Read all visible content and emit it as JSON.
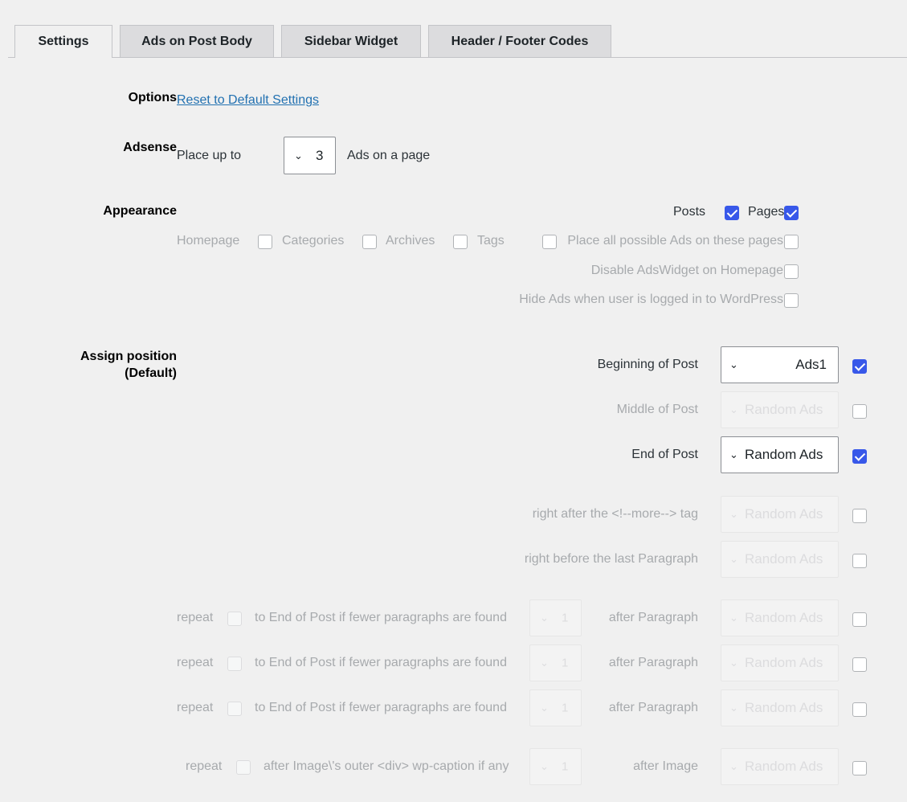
{
  "tabs": [
    "Settings",
    "Ads on Post Body",
    "Sidebar Widget",
    "Header / Footer Codes"
  ],
  "options": {
    "label": "Options",
    "reset_link": "Reset to Default Settings"
  },
  "adsense": {
    "label": "Adsense",
    "prefix": "Place up to",
    "count": "3",
    "suffix": "Ads on a page"
  },
  "appearance": {
    "label": "Appearance",
    "posts": "Posts",
    "pages": "Pages",
    "homepage": "Homepage",
    "categories": "Categories",
    "archives": "Archives",
    "tags": "Tags",
    "place_all": "Place all possible Ads on these pages",
    "disable_widget": "Disable AdsWidget on Homepage",
    "hide_logged": "Hide Ads when user is logged in to WordPress",
    "checked": {
      "posts": true,
      "pages": true,
      "homepage": false,
      "categories": false,
      "archives": false,
      "tags": false,
      "place_all": false,
      "disable_widget": false,
      "hide_logged": false
    }
  },
  "assign": {
    "label_line1": "Assign position",
    "label_line2": "(Default)",
    "rows": [
      {
        "label": "Beginning of Post",
        "value": "Ads1",
        "checked": true
      },
      {
        "label": "Middle of Post",
        "value": "Random Ads",
        "checked": false
      },
      {
        "label": "End of Post",
        "value": "Random Ads",
        "checked": true
      },
      {
        "label": "right after the <!--more--> tag",
        "value": "Random Ads",
        "checked": false
      },
      {
        "label": "right before the last Paragraph",
        "value": "Random Ads",
        "checked": false
      }
    ],
    "repeat_rows": [
      {
        "repeat": "repeat",
        "text": "to End of Post if fewer paragraphs are found",
        "num": "1",
        "after": "after Paragraph",
        "value": "Random Ads",
        "checked": false
      },
      {
        "repeat": "repeat",
        "text": "to End of Post if fewer paragraphs are found",
        "num": "1",
        "after": "after Paragraph",
        "value": "Random Ads",
        "checked": false
      },
      {
        "repeat": "repeat",
        "text": "to End of Post if fewer paragraphs are found",
        "num": "1",
        "after": "after Paragraph",
        "value": "Random Ads",
        "checked": false
      },
      {
        "repeat": "repeat",
        "text": "after Image\\'s outer <div> wp-caption if any",
        "num": "1",
        "after": "after Image",
        "value": "Random Ads",
        "checked": false
      }
    ]
  },
  "icons": {
    "chevron": "chevron-down-icon",
    "checkmark": "check-icon"
  },
  "colors": {
    "accent": "#3858e9",
    "link": "#2271b1",
    "background": "#f0f0f0"
  }
}
